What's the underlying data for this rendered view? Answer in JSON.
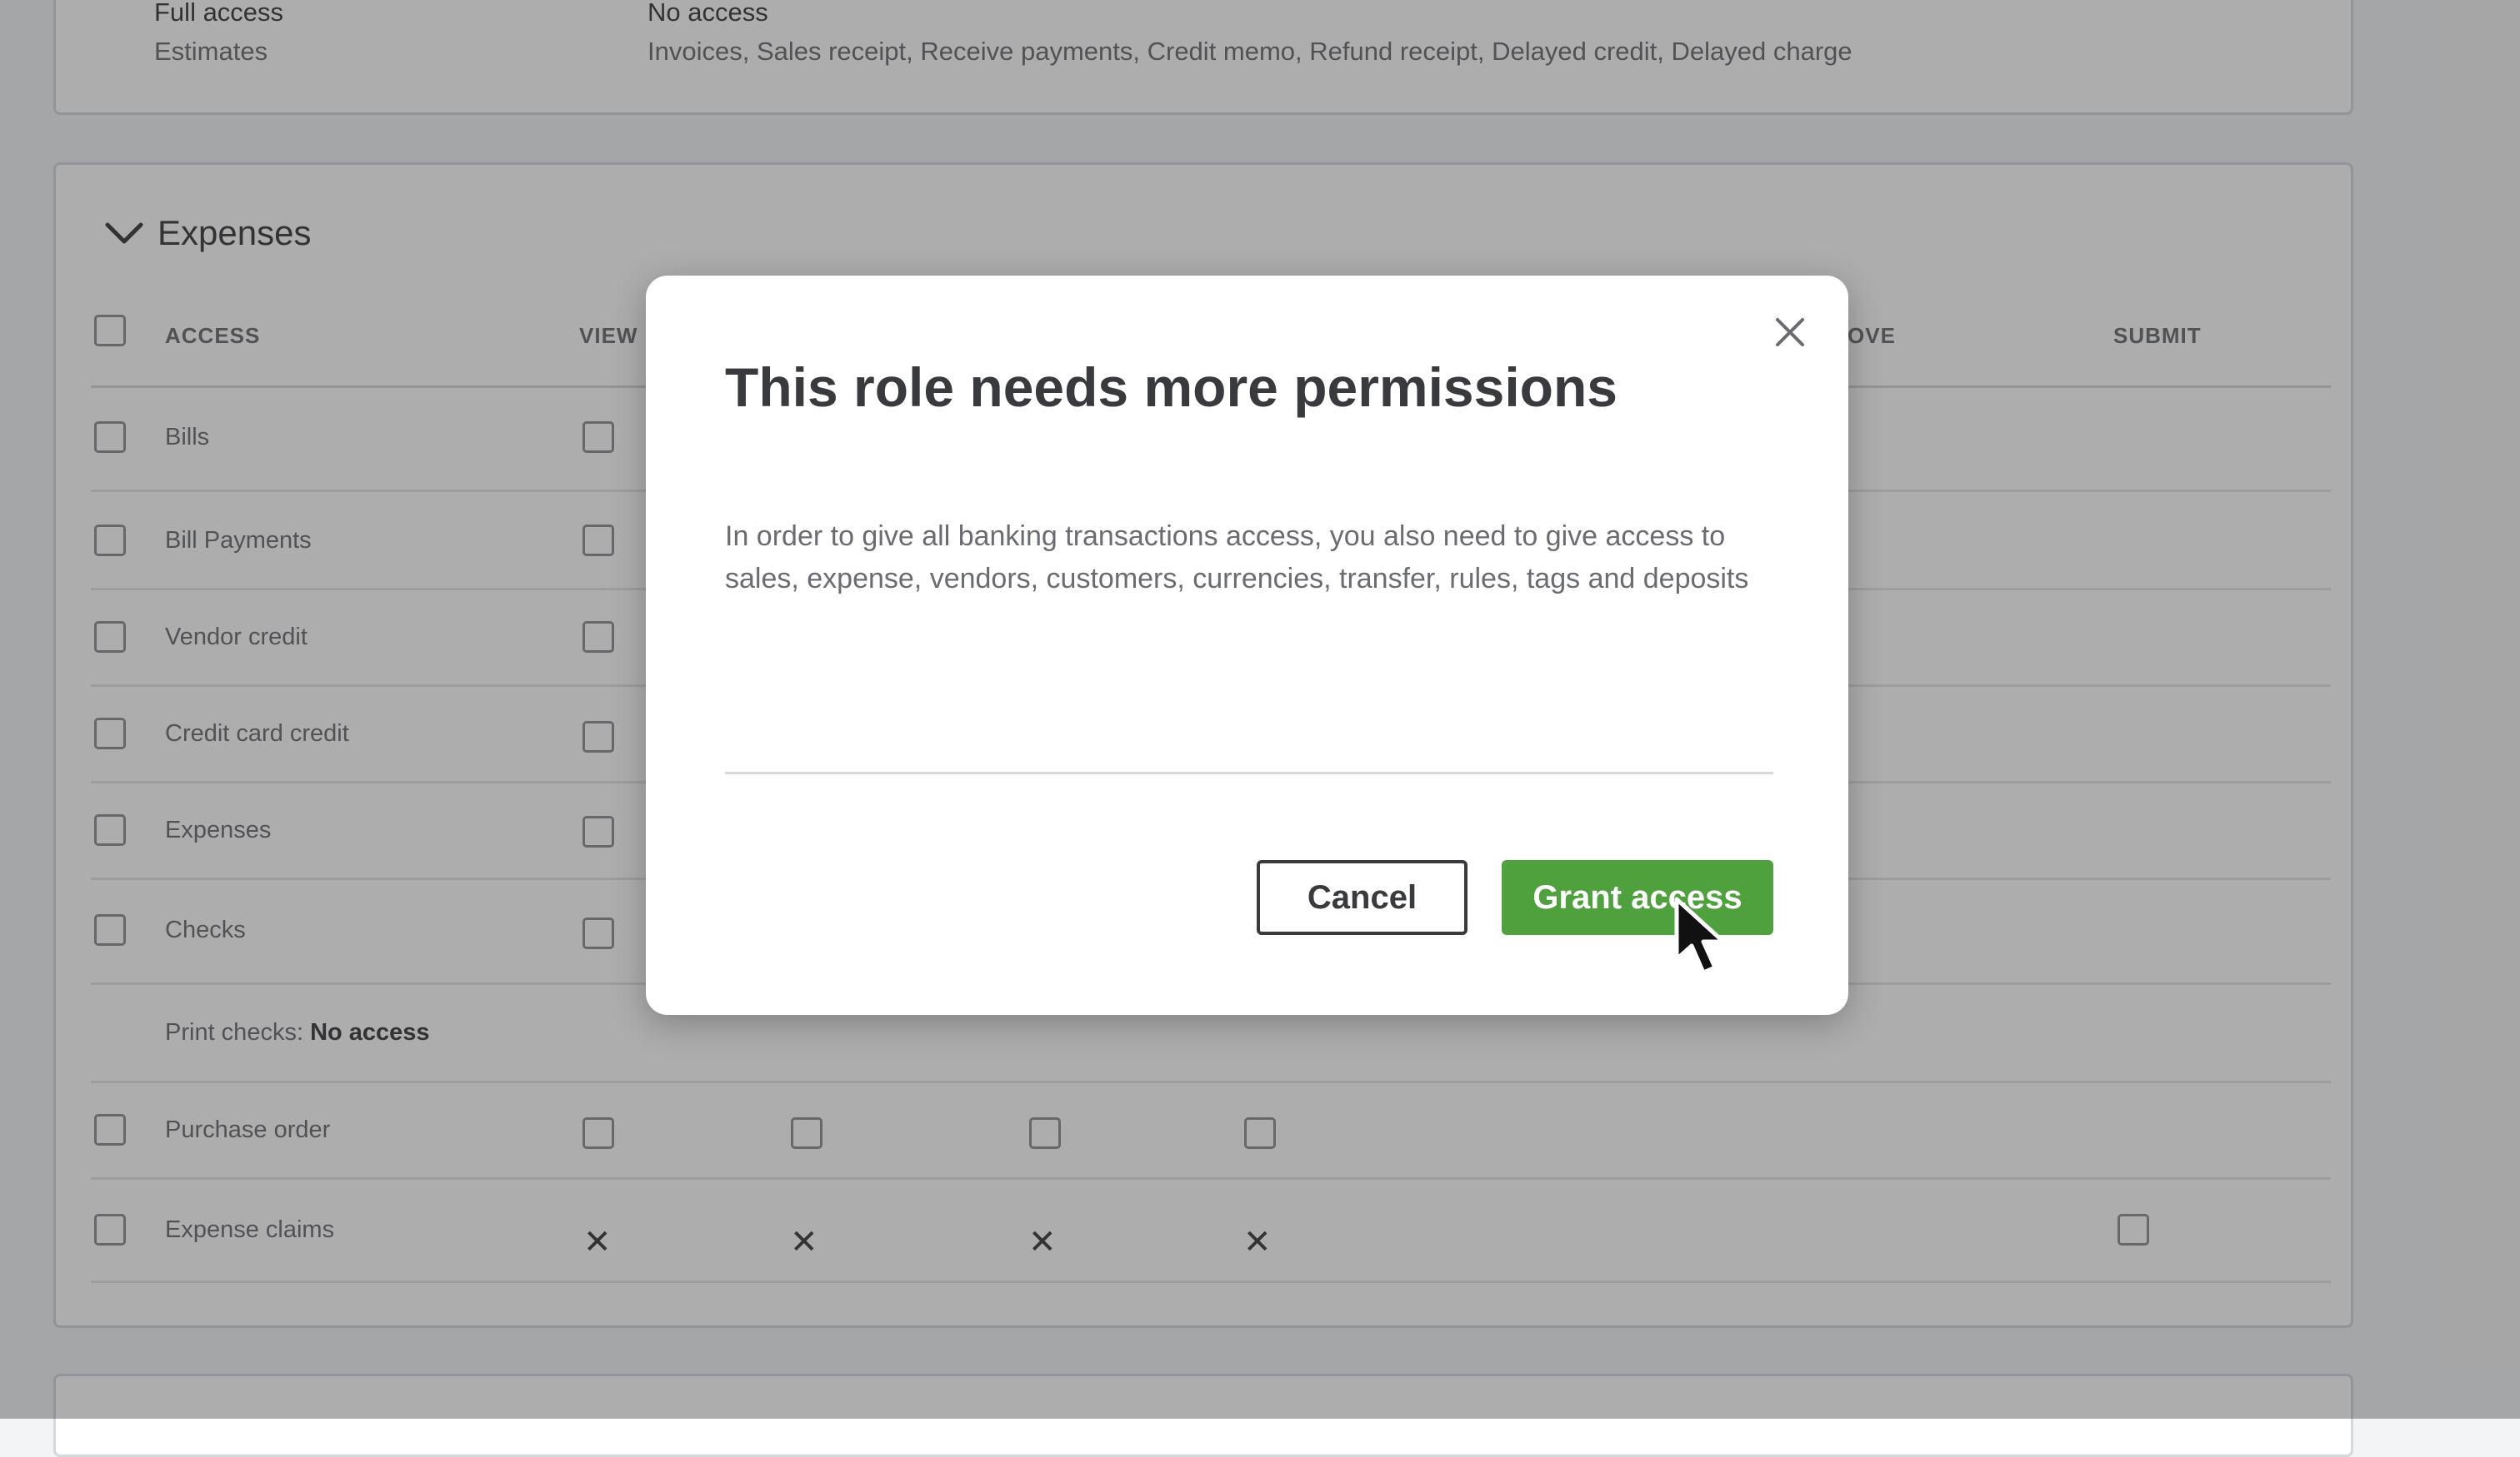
{
  "summary_panel": {
    "row1": {
      "label": "Full access",
      "value": "No access"
    },
    "row2": {
      "label": "Estimates",
      "value": "Invoices, Sales receipt, Receive payments, Credit memo, Refund receipt, Delayed credit, Delayed charge"
    }
  },
  "expenses": {
    "title": "Expenses",
    "columns": {
      "access": "ACCESS",
      "view": "VIEW",
      "approve_partial": "OVE",
      "submit": "SUBMIT"
    },
    "rows": [
      {
        "label": "Bills"
      },
      {
        "label": "Bill Payments"
      },
      {
        "label": "Vendor credit"
      },
      {
        "label": "Credit card credit"
      },
      {
        "label": "Expenses"
      },
      {
        "label": "Checks"
      },
      {
        "label": "Purchase order"
      },
      {
        "label": "Expense claims"
      }
    ],
    "print_checks": {
      "label": "Print checks:",
      "value": "No access"
    },
    "x_glyph": "✕"
  },
  "modal": {
    "title": "This role needs more permissions",
    "body": "In order to give all banking transactions access, you also need to give access to sales, expense, vendors, customers, currencies, transfer, rules, tags and deposits",
    "cancel_label": "Cancel",
    "grant_label": "Grant access",
    "close_icon": "close-icon"
  },
  "colors": {
    "primary_green": "#4ea13c",
    "text_dark": "#393a3d",
    "text_muted": "#6b6c72"
  }
}
